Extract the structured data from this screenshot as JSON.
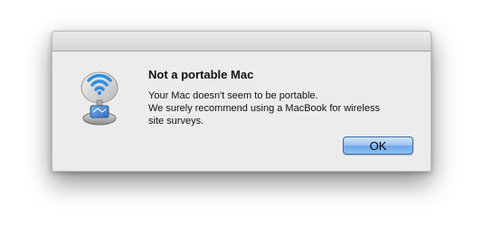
{
  "alert": {
    "title": "Not a portable Mac",
    "message_lines": [
      "Your Mac doesn't seem to be portable.",
      "We surely recommend using a MacBook for wireless",
      "site surveys."
    ],
    "ok_label": "OK"
  },
  "icon": {
    "name": "wifi-radar-satellite-icon"
  },
  "colors": {
    "button_blue": "#8dc1f3",
    "dialog_bg": "#ececec"
  }
}
